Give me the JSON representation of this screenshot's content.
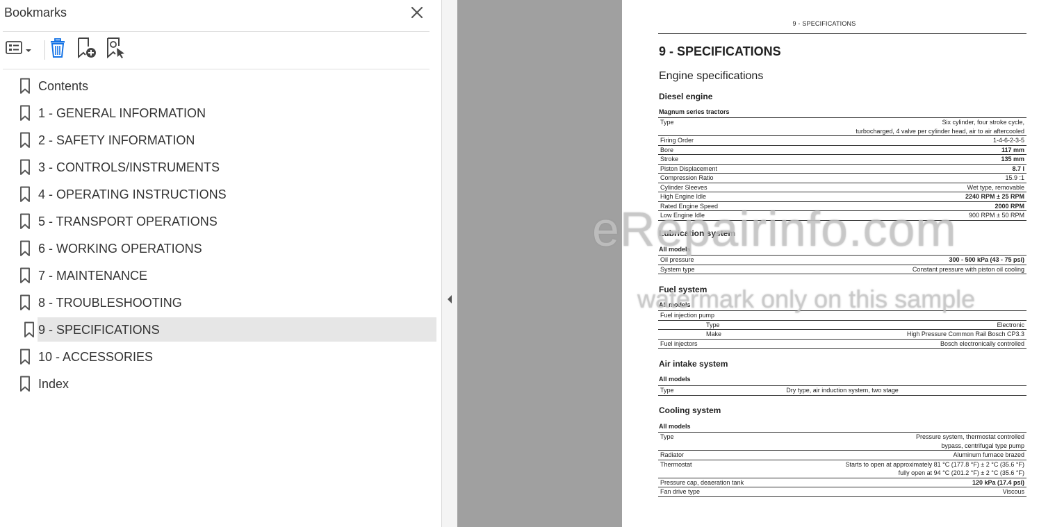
{
  "bookmarks": {
    "title": "Bookmarks",
    "items": [
      {
        "label": "Contents"
      },
      {
        "label": "1 - GENERAL INFORMATION"
      },
      {
        "label": "2 - SAFETY INFORMATION"
      },
      {
        "label": "3 - CONTROLS/INSTRUMENTS"
      },
      {
        "label": "4 - OPERATING INSTRUCTIONS"
      },
      {
        "label": "5 - TRANSPORT OPERATIONS"
      },
      {
        "label": "6 - WORKING OPERATIONS"
      },
      {
        "label": "7 - MAINTENANCE"
      },
      {
        "label": "8 - TROUBLESHOOTING"
      },
      {
        "label": "9 - SPECIFICATIONS"
      },
      {
        "label": "10 - ACCESSORIES"
      },
      {
        "label": "Index"
      }
    ],
    "selected_label": "9 - SPECIFICATIONS"
  },
  "toolbar_icons": [
    "options-menu-icon",
    "delete-bookmark-icon",
    "new-bookmark-icon",
    "find-bookmark-icon"
  ],
  "page": {
    "running_head": "9 - SPECIFICATIONS",
    "title": "9 - SPECIFICATIONS",
    "section": "Engine specifications",
    "diesel": {
      "heading": "Diesel engine",
      "sub": "Magnum series tractors",
      "rows": [
        {
          "label": "Type",
          "value_lines": [
            "Six cylinder, four stroke cycle,",
            "turbocharged, 4 valve per cylinder head, air to air aftercooled"
          ]
        },
        {
          "label": "Firing Order",
          "value": "1-4-6-2-3-5"
        },
        {
          "label": "Bore",
          "value": "117 mm"
        },
        {
          "label": "Stroke",
          "value": "135 mm"
        },
        {
          "label": "Piston Displacement",
          "value": "8.7 l"
        },
        {
          "label": "Compression Ratio",
          "value": "15.9 :1"
        },
        {
          "label": "Cylinder Sleeves",
          "value": "Wet type, removable"
        },
        {
          "label": "High Engine Idle",
          "value": "2240 RPM ± 25 RPM"
        },
        {
          "label": "Rated Engine Speed",
          "value": "2000 RPM"
        },
        {
          "label": "Low Engine Idle",
          "value": "900 RPM ± 50 RPM"
        }
      ]
    },
    "lubrication": {
      "heading": "Lubrication system",
      "sub": "All models",
      "rows": [
        {
          "label": "Oil pressure",
          "value": "300 - 500 kPa (43 - 75 psi)"
        },
        {
          "label": "System type",
          "value": "Constant pressure with piston oil cooling"
        }
      ]
    },
    "fuel": {
      "heading": "Fuel system",
      "sub": "All models",
      "rows": [
        {
          "label": "Fuel injection pump",
          "value": ""
        },
        {
          "label": "Type",
          "value": "Electronic"
        },
        {
          "label": "Make",
          "value": "High Pressure Common Rail Bosch CP3.3"
        },
        {
          "label": "Fuel injectors",
          "value": "Bosch electronically controlled"
        }
      ]
    },
    "air": {
      "heading": "Air intake system",
      "sub": "All models",
      "rows": [
        {
          "label": "Type",
          "value": "Dry type, air induction system, two stage"
        }
      ]
    },
    "cooling": {
      "heading": "Cooling system",
      "sub": "All models",
      "rows": [
        {
          "label": "Type",
          "value_lines": [
            "Pressure system, thermostat controlled",
            "bypass, centrifugal type pump"
          ]
        },
        {
          "label": "Radiator",
          "value": "Aluminum furnace brazed"
        },
        {
          "label": "Thermostat",
          "value_lines": [
            "Starts to open at approximately 81 °C (177.8 °F) ± 2 °C (35.6 °F)",
            "fully open at 94 °C (201.2 °F) ± 2 °C (35.6 °F)"
          ]
        },
        {
          "label": "Pressure cap, deaeration tank",
          "value": "120 kPa (17.4 psi)"
        },
        {
          "label": "Fan drive type",
          "value": "Viscous"
        }
      ]
    }
  },
  "watermark": {
    "line1": "eRepairinfo.com",
    "line2": "watermark only on this sample"
  },
  "colors": {
    "selected_bg": "#e6e6e6",
    "gray_area": "#a0a0a0",
    "icon_blue": "#1473e6"
  }
}
